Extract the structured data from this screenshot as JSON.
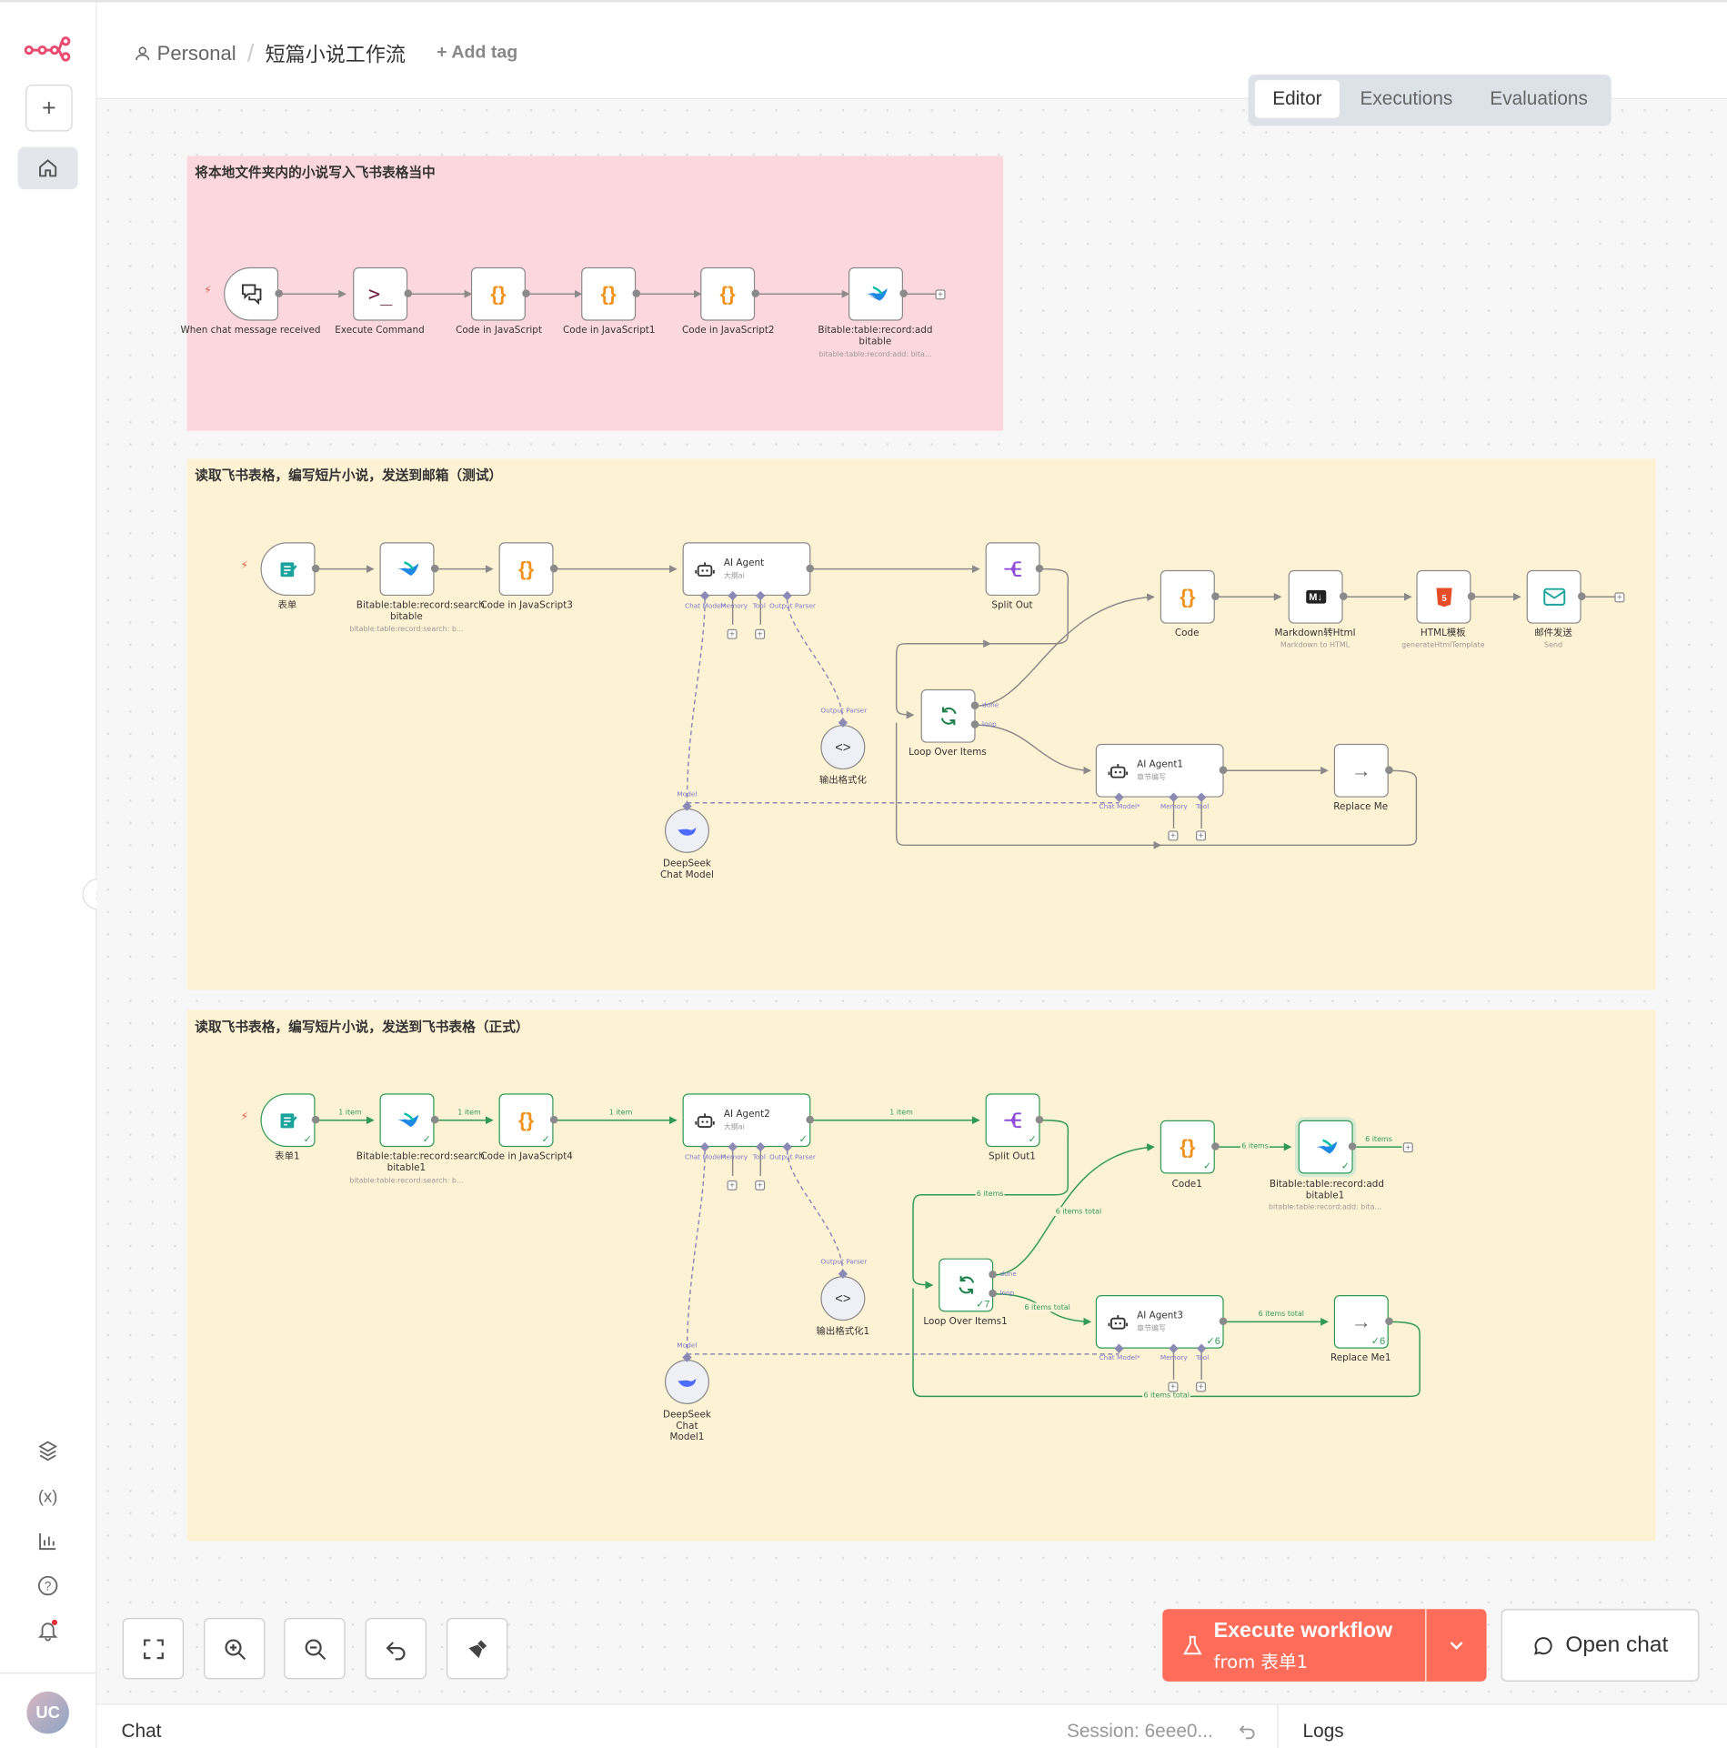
{
  "breadcrumb": {
    "project": "Personal",
    "workflow": "短篇小说工作流",
    "add_tag": "+ Add tag"
  },
  "view_tabs": [
    "Editor",
    "Executions",
    "Evaluations"
  ],
  "view_tabs_active": "Editor",
  "sticky_notes": [
    {
      "title": "将本地文件夹内的小说写入飞书表格当中",
      "color": "#fcd8de"
    },
    {
      "title": "读取飞书表格，编写短片小说，发送到邮箱（测试）",
      "color": "#fdf2d3"
    },
    {
      "title": "读取飞书表格，编写短片小说，发送到飞书表格（正式）",
      "color": "#fdf2d3"
    }
  ],
  "group1": {
    "nodes": [
      {
        "label": "When chat message received",
        "sub": ""
      },
      {
        "label": "Execute Command",
        "sub": ""
      },
      {
        "label": "Code in JavaScript",
        "sub": ""
      },
      {
        "label": "Code in JavaScript1",
        "sub": ""
      },
      {
        "label": "Code in JavaScript2",
        "sub": ""
      },
      {
        "label": "Bitable:table:record:add bitable",
        "sub": "bitable:table:record:add: bita..."
      }
    ]
  },
  "group2": {
    "form": "表单",
    "bitable": "Bitable:table:record:search bitable",
    "bitable_sub": "bitable:table:record:search: b...",
    "code": "Code in JavaScript3",
    "agent": "AI Agent",
    "agent_sub": "大纲ai",
    "split": "Split Out",
    "code2": "Code",
    "md": "Markdown转Html",
    "md_sub": "Markdown to HTML",
    "html": "HTML模板",
    "html_sub": "generateHtmlTemplate",
    "mail": "邮件发送",
    "mail_sub": "Send",
    "loop": "Loop Over Items",
    "agent1": "AI Agent1",
    "agent1_sub": "章节编写",
    "replace": "Replace Me",
    "parser": "输出格式化",
    "model": "DeepSeek Chat Model"
  },
  "group3": {
    "form": "表单1",
    "bitable": "Bitable:table:record:search bitable1",
    "bitable_sub": "bitable:table:record:search: b...",
    "code": "Code in JavaScript4",
    "agent": "AI Agent2",
    "agent_sub": "大纲ai",
    "split": "Split Out1",
    "code2": "Code1",
    "bitable_add": "Bitable:table:record:add bitable1",
    "bitable_add_sub": "bitable:table:record:add: bita...",
    "loop": "Loop Over Items1",
    "loop_count": "7",
    "agent3": "AI Agent3",
    "agent3_sub": "章节编写",
    "agent3_count": "6",
    "replace": "Replace Me1",
    "replace_count": "6",
    "parser": "输出格式化1",
    "model": "DeepSeek Chat Model1",
    "edge_labels": {
      "one_item": "1 item",
      "six_items": "6 items",
      "six_items_total": "6 items total"
    }
  },
  "sub_ports": {
    "chat_model": "Chat Model*",
    "memory": "Memory",
    "tool": "Tool",
    "output_parser": "Output Parser",
    "model": "Model",
    "done": "done",
    "loop": "loop"
  },
  "execute_button": {
    "title": "Execute workflow",
    "subtitle": "from 表单1",
    "color": "#ff6d5a"
  },
  "open_chat": "Open chat",
  "bottom": {
    "chat": "Chat",
    "session": "Session: 6eee0...",
    "logs": "Logs"
  },
  "user_initials": "UC",
  "accent": "#ea4b71"
}
